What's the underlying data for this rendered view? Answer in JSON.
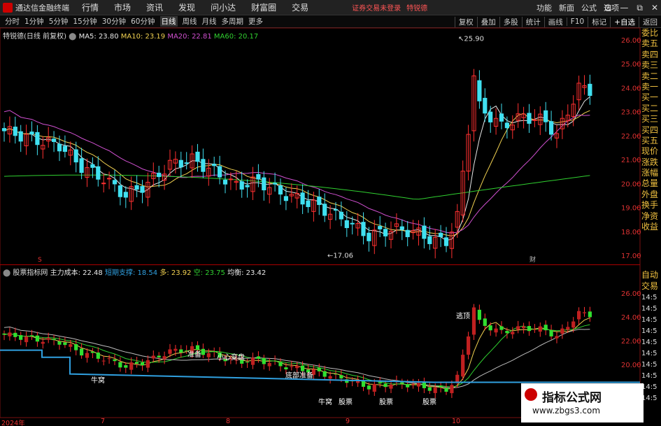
{
  "window": {
    "app_title": "通达信金融终端",
    "menus": [
      "行情",
      "市场",
      "资讯",
      "发现",
      "问小达",
      "财富圈",
      "交易"
    ],
    "notice": "证券交易未登录",
    "special": "特锐德",
    "right_menus": [
      "功能",
      "新面",
      "公式",
      "选项"
    ],
    "controls": [
      "⊡",
      "—",
      "⧉",
      "✕"
    ]
  },
  "toolbar": {
    "periods": [
      "分时",
      "1分钟",
      "5分钟",
      "15分钟",
      "30分钟",
      "60分钟",
      "日线",
      "周线",
      "月线",
      "多周期",
      "更多"
    ],
    "active_period": "日线",
    "right_items": [
      "复权",
      "叠加",
      "多股",
      "统计",
      "画线",
      "F10",
      "标记",
      "+自选",
      "返回"
    ]
  },
  "main_chart": {
    "title": "特锐德(日线 前复权)",
    "ma": [
      {
        "label": "MA5: 23.80",
        "color": "#e8e8e8"
      },
      {
        "label": "MA10: 23.19",
        "color": "#f0d050"
      },
      {
        "label": "MA20: 22.81",
        "color": "#d050d0"
      },
      {
        "label": "MA60: 20.17",
        "color": "#30d030"
      }
    ],
    "high_label": "25.90",
    "low_label": "17.06",
    "marker_s": "S",
    "marker_cai": "财",
    "y_ticks": [
      "26.00",
      "25.00",
      "24.00",
      "23.00",
      "22.00",
      "21.00",
      "20.00",
      "19.00",
      "18.00",
      "17.00"
    ]
  },
  "sub_chart": {
    "title": "股票指标网",
    "items": [
      {
        "label": "主力成本: 22.48",
        "color": "#e8e8e8"
      },
      {
        "label": "短期支撑: 18.54",
        "color": "#30a0e0"
      },
      {
        "label": "多: 23.92",
        "color": "#f0d050"
      },
      {
        "label": "空: 23.75",
        "color": "#30d030"
      },
      {
        "label": "均衡: 23.42",
        "color": "#e8e8e8"
      }
    ],
    "y_ticks": [
      "26.00",
      "24.00",
      "22.00",
      "20.00"
    ],
    "annotations": [
      "逃顶",
      "准备",
      "小心变盘",
      "底部准备",
      "牛窝",
      "牛窝",
      "股票",
      "股票",
      "股票"
    ]
  },
  "right_panel": {
    "labels1": [
      "委比",
      "卖五",
      "卖四",
      "卖三",
      "卖二",
      "卖一",
      "买一",
      "买二",
      "买三",
      "买四",
      "买五",
      "现价",
      "涨跌",
      "涨幅",
      "总量",
      "外盘",
      "换手",
      "净资",
      "收益"
    ],
    "labels2": [
      "自动",
      "交易",
      "14:5",
      "14:5",
      "14:5",
      "14:5",
      "14:5",
      "14:5",
      "14:5",
      "14:5",
      "14:5",
      "14:5"
    ]
  },
  "x_axis": {
    "labels": [
      "2024年",
      "7",
      "8",
      "9",
      "10"
    ]
  },
  "watermark": {
    "title": "指标公式网",
    "url": "www.zbgs3.com"
  }
}
